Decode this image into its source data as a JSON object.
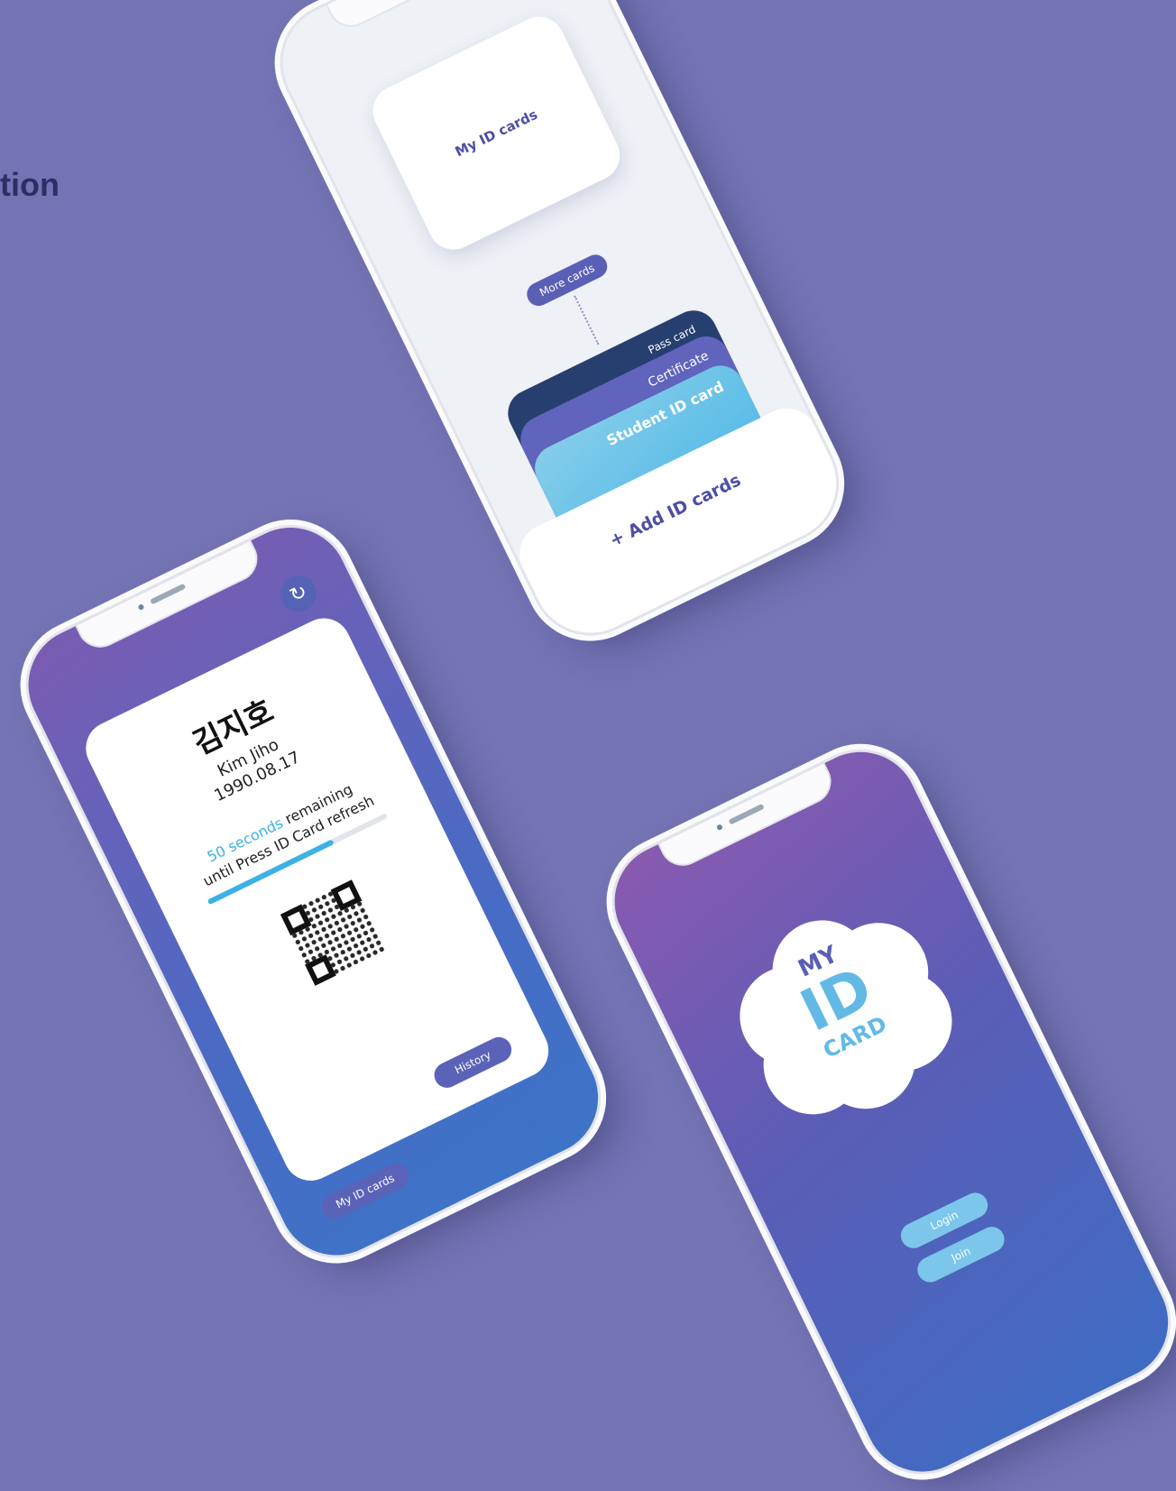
{
  "heading": "tion",
  "phone_cards": {
    "top_card": "My ID cards",
    "more_button": "More cards",
    "stack": [
      "Pass card",
      "Certificate",
      "Student ID card"
    ],
    "add_button": "+ Add ID cards"
  },
  "phone_id": {
    "name_korean": "김지호",
    "name_english": "Kim Jiho",
    "birthdate": "1990.08.17",
    "seconds": "50 seconds",
    "remaining": " remaining",
    "refresh_text": "until Press ID Card refresh",
    "progress": 0.7,
    "history_button": "History",
    "mycards_button": "My ID cards"
  },
  "phone_login": {
    "logo_my": "MY",
    "logo_id": "ID",
    "logo_card": "CARD",
    "login_button": "Login",
    "join_button": "Join"
  },
  "colors": {
    "background": "#7474b5",
    "accent_blue": "#3cb1e6",
    "accent_purple": "#5a5fb6"
  },
  "icons": {
    "refresh": "refresh-icon",
    "qr": "qr-code-icon"
  }
}
